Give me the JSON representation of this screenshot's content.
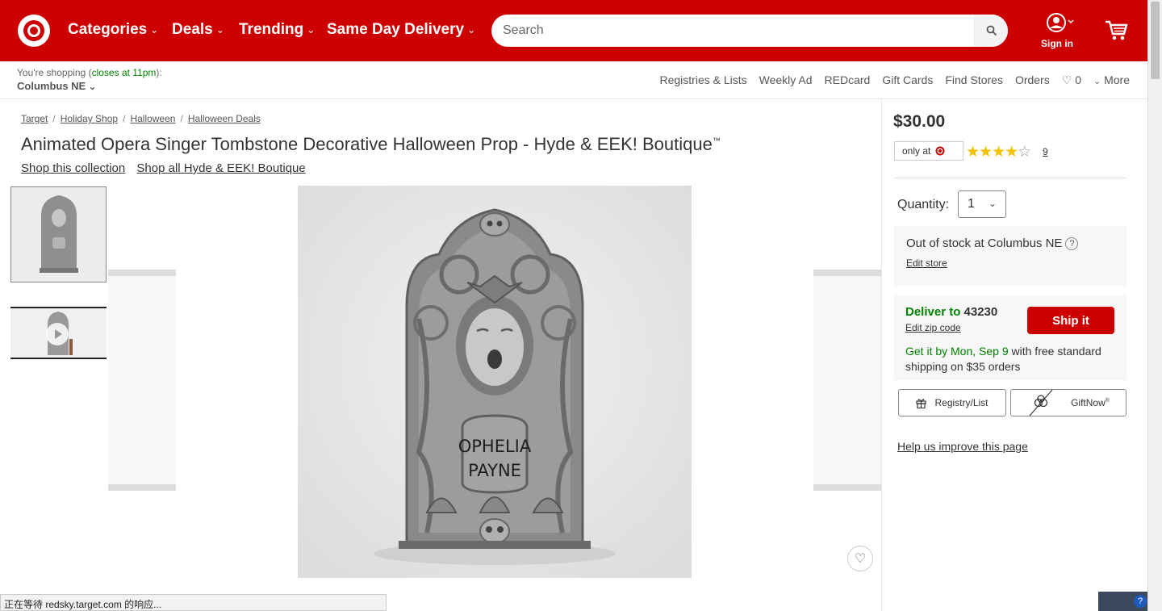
{
  "header": {
    "nav": [
      {
        "label": "Categories"
      },
      {
        "label": "Deals"
      },
      {
        "label": "Trending"
      },
      {
        "label": "Same Day Delivery"
      }
    ],
    "search_placeholder": "Search",
    "signin_label": "Sign in"
  },
  "subheader": {
    "shopping_prefix": "You're shopping (",
    "closes": "closes at 11pm",
    "shopping_suffix": "):",
    "store": "Columbus NE",
    "links": [
      "Registries & Lists",
      "Weekly Ad",
      "REDcard",
      "Gift Cards",
      "Find Stores",
      "Orders"
    ],
    "favorites_count": "0",
    "more_label": "More"
  },
  "breadcrumb": [
    "Target",
    "Holiday Shop",
    "Halloween",
    "Halloween Deals"
  ],
  "product": {
    "title": "Animated Opera Singer Tombstone Decorative Halloween Prop - Hyde & EEK! Boutique",
    "title_mark": "™",
    "collection_link": "Shop this collection",
    "brand_link": "Shop all Hyde & EEK! Boutique",
    "tombstone_text_1": "OPHELIA",
    "tombstone_text_2": "PAYNE"
  },
  "buybox": {
    "price": "$30.00",
    "only_at": "only at",
    "rating": 4.5,
    "review_count": "9",
    "quantity_label": "Quantity:",
    "quantity_value": "1",
    "stock_text": "Out of stock at Columbus NE",
    "edit_store": "Edit store",
    "deliver_label": "Deliver to",
    "zip": "43230",
    "edit_zip": "Edit zip code",
    "ship_button": "Ship it",
    "get_it": "Get it by Mon, Sep 9",
    "shipping_text": " with free standard shipping on $35 orders",
    "registry_button": "Registry/List",
    "giftnow_button": "GiftNow",
    "giftnow_mark": "®",
    "help_link": "Help us improve this page"
  },
  "statusbar_text": "正在等待 redsky.target.com 的响应...",
  "colors": {
    "brand_red": "#cc0000",
    "green": "#008300",
    "star": "#f2c200"
  }
}
